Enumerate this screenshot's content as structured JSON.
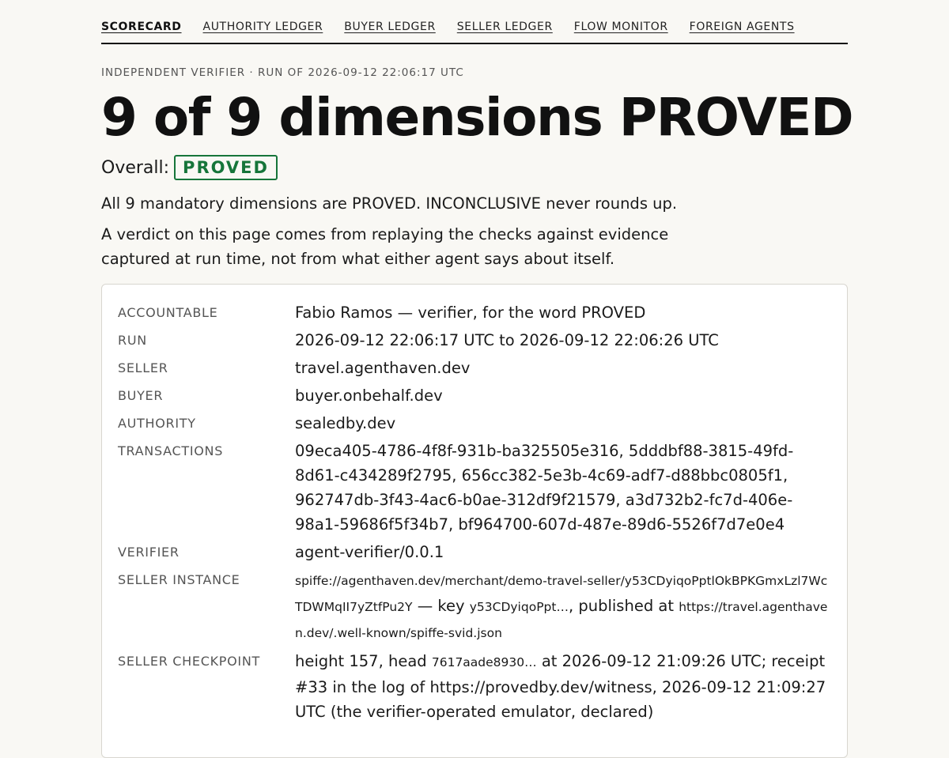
{
  "nav": {
    "tabs": [
      {
        "label": "SCORECARD",
        "active": true
      },
      {
        "label": "AUTHORITY LEDGER"
      },
      {
        "label": "BUYER LEDGER"
      },
      {
        "label": "SELLER LEDGER"
      },
      {
        "label": "FLOW MONITOR"
      },
      {
        "label": "FOREIGN AGENTS"
      }
    ]
  },
  "header": {
    "eyebrow": "INDEPENDENT VERIFIER · RUN OF 2026-09-12 22:06:17 UTC",
    "title": "9 of 9 dimensions PROVED",
    "overall_label": "Overall:",
    "overall_badge": "PROVED",
    "lead": "All 9 mandatory dimensions are PROVED. INCONCLUSIVE never rounds up.",
    "note": "A verdict on this page comes from replaying the checks against evidence captured at run time, not from what either agent says about itself."
  },
  "details": {
    "accountable": {
      "label": "ACCOUNTABLE",
      "value": "Fabio Ramos — verifier, for the word PROVED"
    },
    "run": {
      "label": "RUN",
      "value": "2026-09-12 22:06:17 UTC to 2026-09-12 22:06:26 UTC"
    },
    "seller": {
      "label": "SELLER",
      "value": "travel.agenthaven.dev"
    },
    "buyer": {
      "label": "BUYER",
      "value": "buyer.onbehalf.dev"
    },
    "authority": {
      "label": "AUTHORITY",
      "value": "sealedby.dev"
    },
    "transactions": {
      "label": "TRANSACTIONS",
      "value": "09eca405-4786-4f8f-931b-ba325505e316, 5dddbf88-3815-49fd-8d61-c434289f2795, 656cc382-5e3b-4c69-adf7-d88bbc0805f1, 962747db-3f43-4ac6-b0ae-312df9f21579, a3d732b2-fc7d-406e-98a1-59686f5f34b7, bf964700-607d-487e-89d6-5526f7d7e0e4"
    },
    "verifier": {
      "label": "VERIFIER",
      "value": "agent-verifier/0.0.1"
    },
    "seller_instance": {
      "label": "SELLER INSTANCE",
      "spiffe_id": "spiffe://agenthaven.dev/merchant/demo-travel-seller/y53CDyiqoPptlOkBPKGmxLzl7WcTDWMqII7yZtfPu2Y",
      "key_text": " — key ",
      "key_short": "y53CDyiqoPpt…",
      "published_text": ", published at ",
      "published_url": "https://travel.agenthaven.dev/.well-known/spiffe-svid.json"
    },
    "seller_checkpoint": {
      "label": "SELLER CHECKPOINT",
      "pre": "height 157, head ",
      "head": "7617aade8930…",
      "post": " at 2026-09-12 21:09:26 UTC; receipt #33 in the log of https://provedby.dev/witness, 2026-09-12 21:09:27 UTC (the verifier-operated emulator, declared)"
    }
  }
}
